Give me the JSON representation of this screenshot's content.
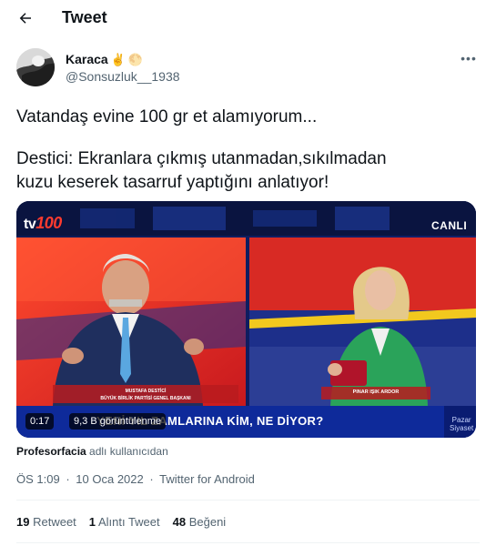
{
  "header": {
    "title": "Tweet",
    "back_icon": "arrow-left-icon"
  },
  "author": {
    "name": "Karaca",
    "badges": [
      "✌️",
      "🌕"
    ],
    "handle": "@Sonsuzluk__1938",
    "more_icon": "ellipsis-icon"
  },
  "tweet": {
    "lines_1": [
      "Vatandaş evine 100 gr et alamıyorum..."
    ],
    "lines_2": [
      "Destici: Ekranlara çıkmış utanmadan,sıkılmadan",
      "kuzu keserek tasarruf yaptığını anlatıyor!"
    ]
  },
  "media": {
    "channel": "tv",
    "channel_num": "100",
    "live": "CANLI",
    "lower_left_1": "MUSTAFA DESTİCİ",
    "lower_left_2": "BÜYÜK BİRLİK PARTİSİ GENEL BAŞKANI",
    "lower_right": "PINAR IŞIK ARDOR",
    "ticker": "YENİ YIL ZAMLARINA KİM, NE DİYOR?",
    "ticker_side_1": "Pazar",
    "ticker_side_2": "Siyaset",
    "time": "0:17",
    "views": "9,3 B görüntülenme",
    "colors": {
      "studio_blue": "#1c2a78",
      "accent_red": "#e8322d",
      "banner_blue": "#1a3fa8"
    }
  },
  "attribution": {
    "name": "Profesorfacia",
    "suffix": "adlı kullanıcıdan"
  },
  "meta": {
    "time": "ÖS 1:09",
    "sep": "·",
    "date": "10 Oca 2022",
    "source": "Twitter for Android"
  },
  "stats": {
    "retweets": "19",
    "retweets_label": "Retweet",
    "quotes": "1",
    "quotes_label": "Alıntı Tweet",
    "likes": "48",
    "likes_label": "Beğeni"
  }
}
